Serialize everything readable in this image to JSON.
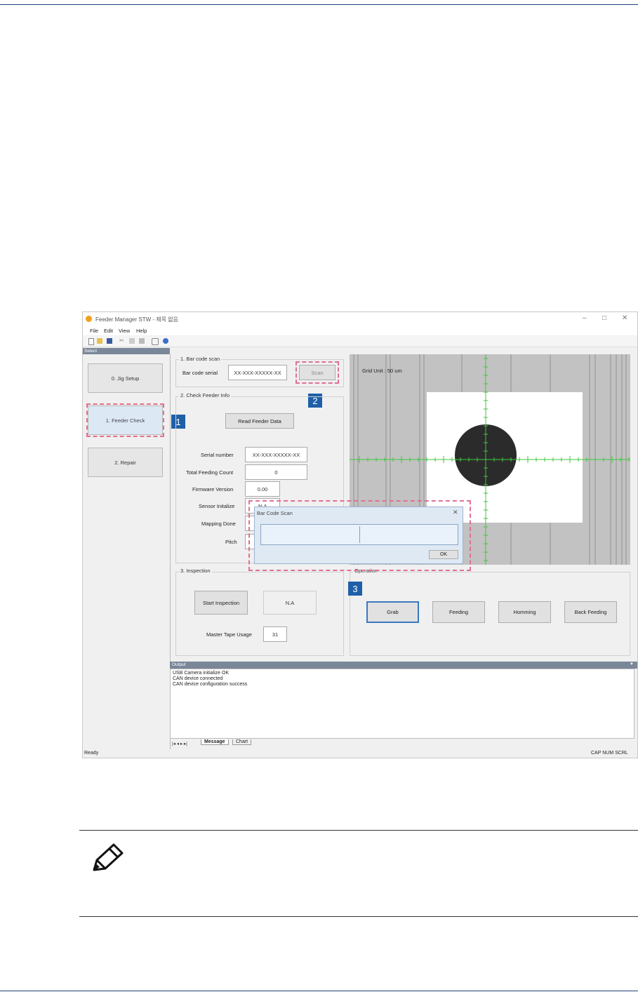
{
  "window": {
    "title": "Feeder Manager STW - 제목 없음",
    "minimize": "–",
    "maximize": "□",
    "close": "✕"
  },
  "menu": [
    "File",
    "Edit",
    "View",
    "Help"
  ],
  "select_panel": {
    "header": "Select",
    "buttons": [
      "0. Jig Setup",
      "1. Feeder Check",
      "2. Repair"
    ]
  },
  "barcode_scan": {
    "group_label": "1. Bar code scan",
    "serial_label": "Bar code serial",
    "serial_value": "XX-XXX-XXXXX-XX",
    "scan_button": "Scan"
  },
  "feeder_info": {
    "group_label": "2. Check Feeder Info",
    "read_button": "Read Feeder Data",
    "fields": [
      {
        "label": "Serial number",
        "value": "XX-XXX-XXXXX-XX"
      },
      {
        "label": "Total Feeding Count",
        "value": "0"
      },
      {
        "label": "Firmware Version",
        "value": "0.00"
      },
      {
        "label": "Sensor Initalize",
        "value": "N.A"
      },
      {
        "label": "Mapping Done",
        "value": ""
      },
      {
        "label": "Pitch",
        "value": ""
      }
    ]
  },
  "inspection": {
    "group_label": "3. Inspection",
    "start_button": "Start Inspection",
    "result_value": "N.A",
    "usage_label": "Master Tape Usage",
    "usage_value": "31"
  },
  "camera": {
    "grid_unit": "Grid Unit : 50 um"
  },
  "operation": {
    "group_label": "Operation",
    "buttons": [
      "Grab",
      "Feeding",
      "Homming",
      "Back Feeding"
    ]
  },
  "dialog": {
    "title": "Bar Code Scan",
    "close": "✕",
    "ok_button": "OK"
  },
  "badges": [
    "1",
    "2",
    "3"
  ],
  "output": {
    "header": "Output",
    "lines": [
      "USB Camera initialize OK",
      "CAN device connected",
      "CAN device configuration success"
    ],
    "tabs": [
      "Message",
      "Chart"
    ],
    "nav": "|◂ ◂ ▸ ▸|"
  },
  "status": {
    "left": "Ready",
    "right": "CAP NUM SCRL"
  },
  "colors": {
    "highlight_dash": "#e07090",
    "badge": "#1f5fa8",
    "crosshair": "#3ec83e"
  }
}
